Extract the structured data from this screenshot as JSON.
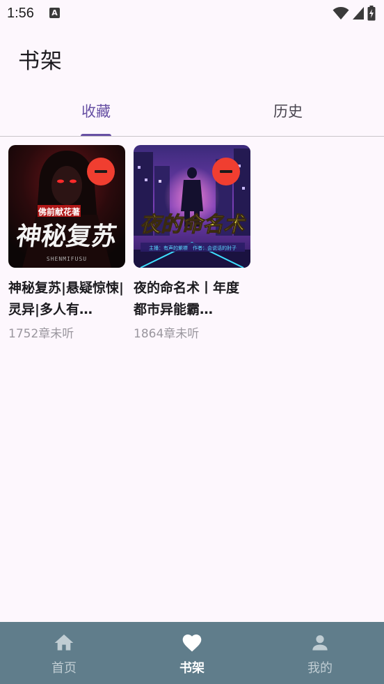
{
  "status_bar": {
    "time": "1:56",
    "notification_icon": "A"
  },
  "header": {
    "title": "书架"
  },
  "tabs": [
    {
      "label": "收藏",
      "active": true
    },
    {
      "label": "历史",
      "active": false
    }
  ],
  "books": [
    {
      "title": "神秘复苏|悬疑惊悚|灵异|多人有…",
      "subtitle": "1752章未听",
      "cover": {
        "author_tag": "佛前献花著",
        "title_text": "神秘复苏",
        "small_text": "SHENMIFUSU"
      }
    },
    {
      "title": "夜的命名术丨年度都市异能霸…",
      "subtitle": "1864章未听",
      "cover": {
        "title_text": "夜的命名术",
        "credit_text": "主播：有声的紫襟　作者：会说话的肘子"
      }
    }
  ],
  "bottom_nav": [
    {
      "label": "首页",
      "icon": "home-icon",
      "active": false
    },
    {
      "label": "书架",
      "icon": "heart-icon",
      "active": true
    },
    {
      "label": "我的",
      "icon": "person-icon",
      "active": false
    }
  ],
  "colors": {
    "background": "#fdf7fd",
    "primary": "#6750a4",
    "nav_bar": "#607d8b",
    "remove_button": "#f03e30"
  }
}
